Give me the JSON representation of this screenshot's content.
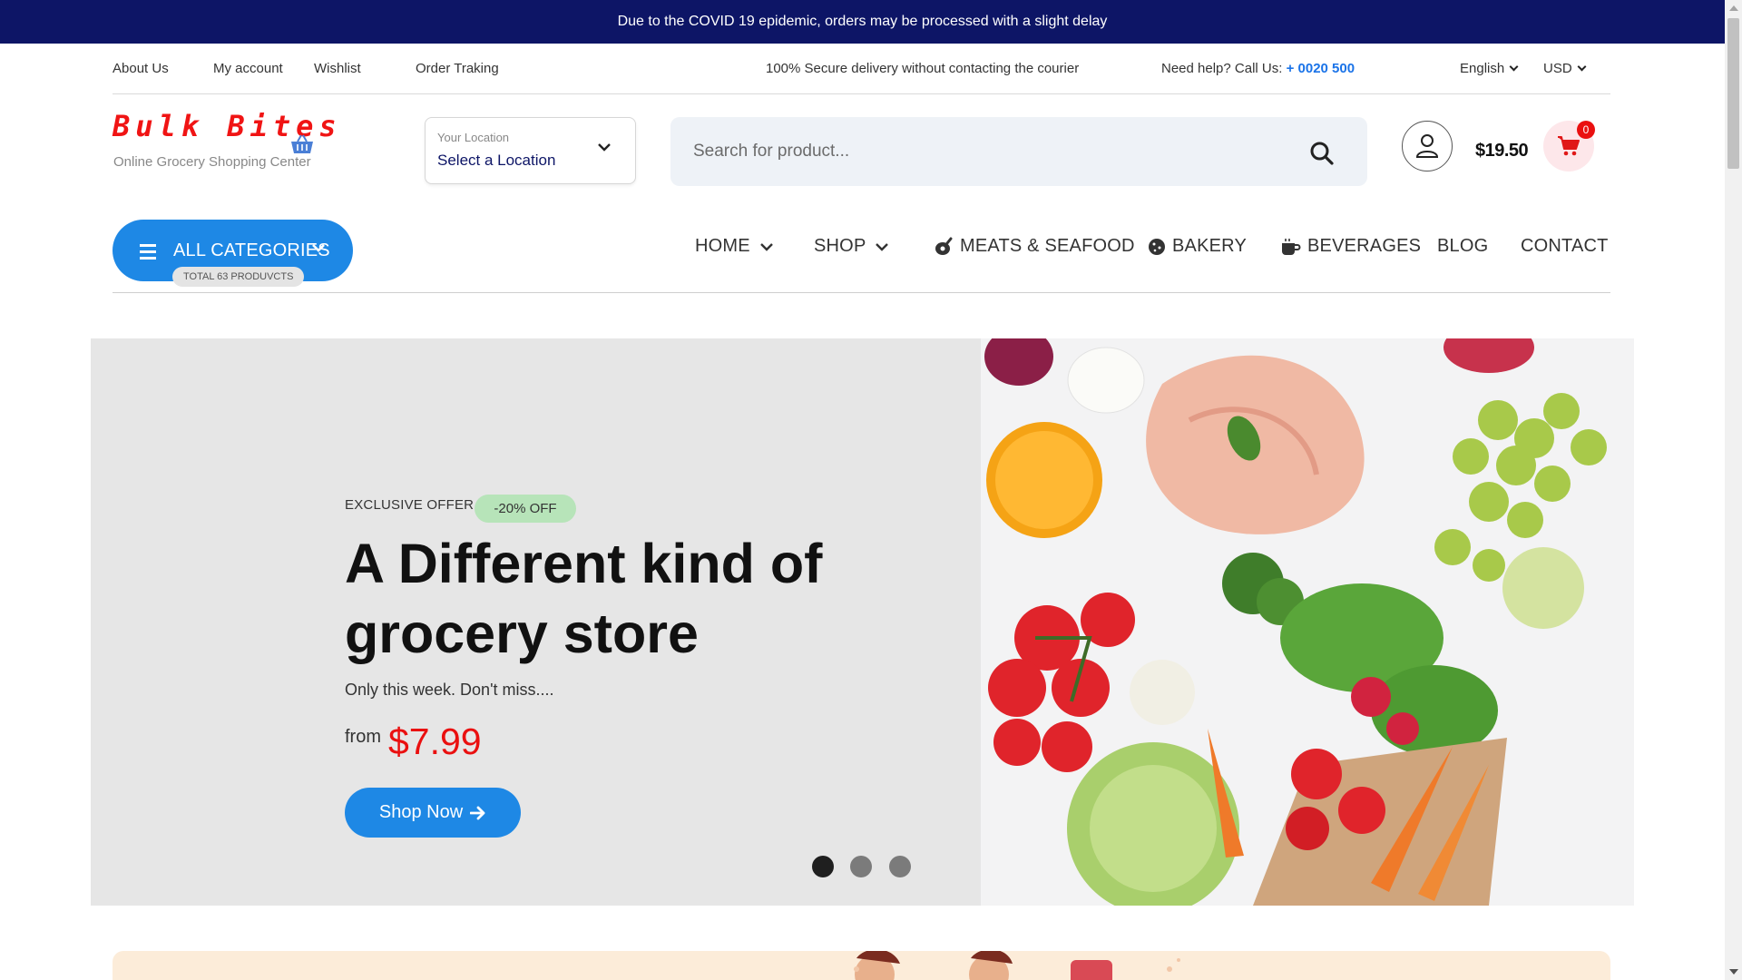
{
  "announcement": "Due to the COVID 19 epidemic, orders may be processed with a slight delay",
  "topbar": {
    "links": [
      "About Us",
      "My account",
      "Wishlist",
      "Order Traking"
    ],
    "secure_text": "100% Secure delivery without contacting the courier",
    "help_text": "Need help? Call Us:",
    "phone": "+ 0020 500",
    "language": "English",
    "currency": "USD"
  },
  "header": {
    "logo_text": "Bulk Bites",
    "tagline": "Online Grocery Shopping Center",
    "location_label": "Your Location",
    "location_value": "Select a Location",
    "search_placeholder": "Search for product...",
    "cart_total": "$19.50",
    "cart_count": "0"
  },
  "nav": {
    "all_categories": "ALL CATEGORIES",
    "total_products": "TOTAL 63 PRODUVCTS",
    "items": [
      "HOME",
      "SHOP",
      "MEATS & SEAFOOD",
      "BAKERY",
      "BEVERAGES",
      "BLOG",
      "CONTACT"
    ]
  },
  "hero": {
    "eyebrow": "EXCLUSIVE OFFER",
    "discount": "-20% OFF",
    "title": "A Different kind of grocery store",
    "subtitle": "Only this week. Don't miss....",
    "from_label": "from",
    "price": "$7.99",
    "cta": "Shop Now",
    "slides": 3,
    "active_slide": 1
  },
  "colors": {
    "announcement_bg": "#0d1566",
    "accent_blue": "#1e88e5",
    "price_red": "#ea1010",
    "badge_green": "#b7e4b9"
  }
}
